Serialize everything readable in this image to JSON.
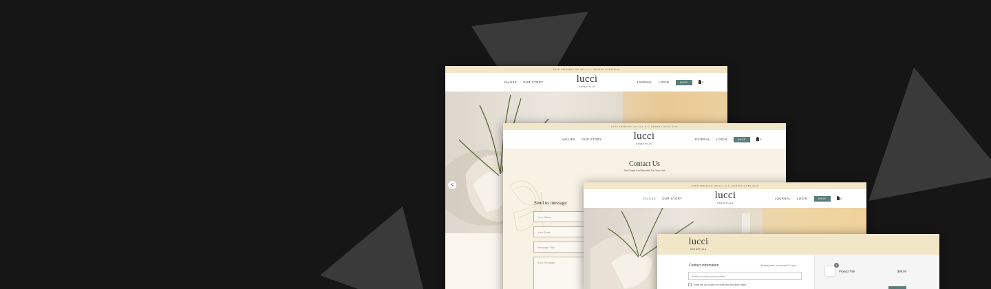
{
  "colors": {
    "background": "#161616",
    "triangle": "#3a3a3a",
    "promo_bar": "#f2e6c8",
    "accent": "#5a7d7b",
    "cream": "#f8f2e4"
  },
  "site": {
    "promo": "FREE SHIPPING ON ALL U.S. ORDERS OVER $100",
    "logo": "lucci",
    "logo_sub": "ESSENTIALS",
    "nav_left": [
      "VALUES",
      "OUR STORY"
    ],
    "nav_right": [
      "JOURNAL",
      "LOGIN"
    ],
    "shop": "SHOP",
    "cart_count": "0"
  },
  "icons": {
    "cart": "shopping-bag-icon",
    "prev": "chevron-left-icon"
  },
  "home": {
    "prev_glyph": "<"
  },
  "contact": {
    "title": "Contact Us",
    "subtitle": "The Power And Benefits For Your Hair",
    "form_title": "Send us message",
    "name_placeholder": "Your Name",
    "email_placeholder": "Your Email",
    "message_title_placeholder": "Message Title",
    "message_placeholder": "Your Message"
  },
  "checkout": {
    "contact_title": "Contact information",
    "login_prompt": "Already have an account? Log in",
    "contact_placeholder": "Email or mobile phone number",
    "offers_label": "Keep me up to date on news and exclusive offers",
    "product_title": "Product Title",
    "product_qty": "1",
    "product_price": "$99.99"
  }
}
